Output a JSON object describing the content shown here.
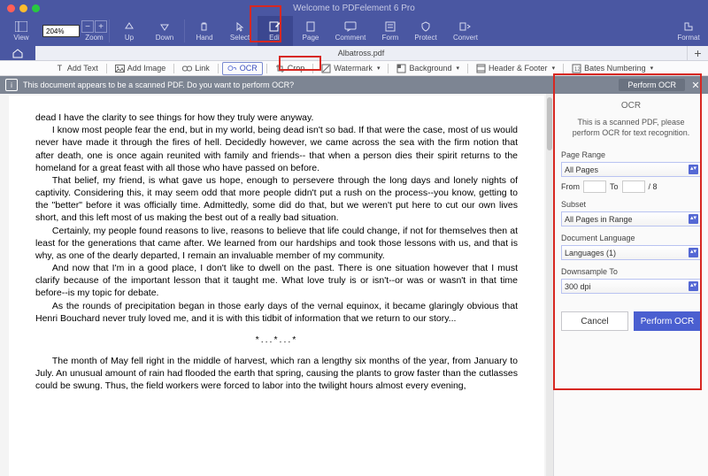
{
  "window_title": "Welcome to PDFelement 6 Pro",
  "toolbar": {
    "view": "View",
    "zoom_label": "Zoom",
    "zoom_value": "204%",
    "up": "Up",
    "down": "Down",
    "hand": "Hand",
    "select": "Select",
    "edit": "Edit",
    "page": "Page",
    "comment": "Comment",
    "form": "Form",
    "protect": "Protect",
    "convert": "Convert",
    "format": "Format"
  },
  "tabs": {
    "document_name": "Albatross.pdf"
  },
  "subtoolbar": {
    "add_text": "Add Text",
    "add_image": "Add Image",
    "link": "Link",
    "ocr": "OCR",
    "crop": "Crop",
    "watermark": "Watermark",
    "background": "Background",
    "header_footer": "Header & Footer",
    "bates": "Bates Numbering"
  },
  "ocr_banner": {
    "message": "This document appears to be a scanned PDF. Do you want to perform OCR?",
    "button": "Perform OCR"
  },
  "document": {
    "p1": "dead I have the clarity to see things for how they truly were anyway.",
    "p2": "I know most people fear the end, but in my world, being dead isn't so bad. If that were the case, most of us would never have made it through the fires of hell. Decidedly however, we came across the sea with the firm notion that after death, one is once again reunited with family and friends-- that when a person dies their spirit returns to the homeland for a great feast with all those who have passed on before.",
    "p3": "That belief, my friend, is what gave us hope, enough to persevere through the long days and lonely nights of captivity. Considering this, it may seem odd that more people didn't put a rush on the process--you know, getting to the \"better\" before it was officially time. Admittedly, some did do that, but we weren't put here to cut our own lives short, and this left most of us making the best out of a really bad situation.",
    "p4": "Certainly, my people found reasons to live, reasons to believe that life could change, if not for themselves then at least for the generations that came after. We learned from our hardships and took those lessons with us, and that is why, as one of the dearly departed, I remain an invaluable member of my community.",
    "p5": "And now that I'm in a good place, I don't like to dwell on the past. There is one situation however that I must clarify because of the important lesson that it taught me. What love truly is or isn't--or was or wasn't in that time before--is my topic for debate.",
    "p6": "As the rounds of precipitation began in those early days of the vernal equinox, it became glaringly obvious that Henri Bouchard never truly loved me, and it is with this tidbit of information that we return to our story...",
    "ornament": "*...*...*",
    "p7": "The month of May fell right in the middle of harvest, which ran a lengthy six months of the year, from January to July. An unusual amount of rain had flooded the earth that spring, causing the plants to grow faster than the cutlasses could be swung. Thus, the field workers were forced to labor into the twilight hours almost every evening,"
  },
  "panel": {
    "title": "OCR",
    "hint": "This is a scanned PDF, please perform OCR for text recognition.",
    "page_range_label": "Page Range",
    "page_range_value": "All Pages",
    "from_label": "From",
    "to_label": "To",
    "total_pages": "/ 8",
    "subset_label": "Subset",
    "subset_value": "All Pages in Range",
    "lang_label": "Document Language",
    "lang_value": "Languages (1)",
    "downsample_label": "Downsample To",
    "downsample_value": "300 dpi",
    "cancel": "Cancel",
    "perform": "Perform OCR"
  }
}
